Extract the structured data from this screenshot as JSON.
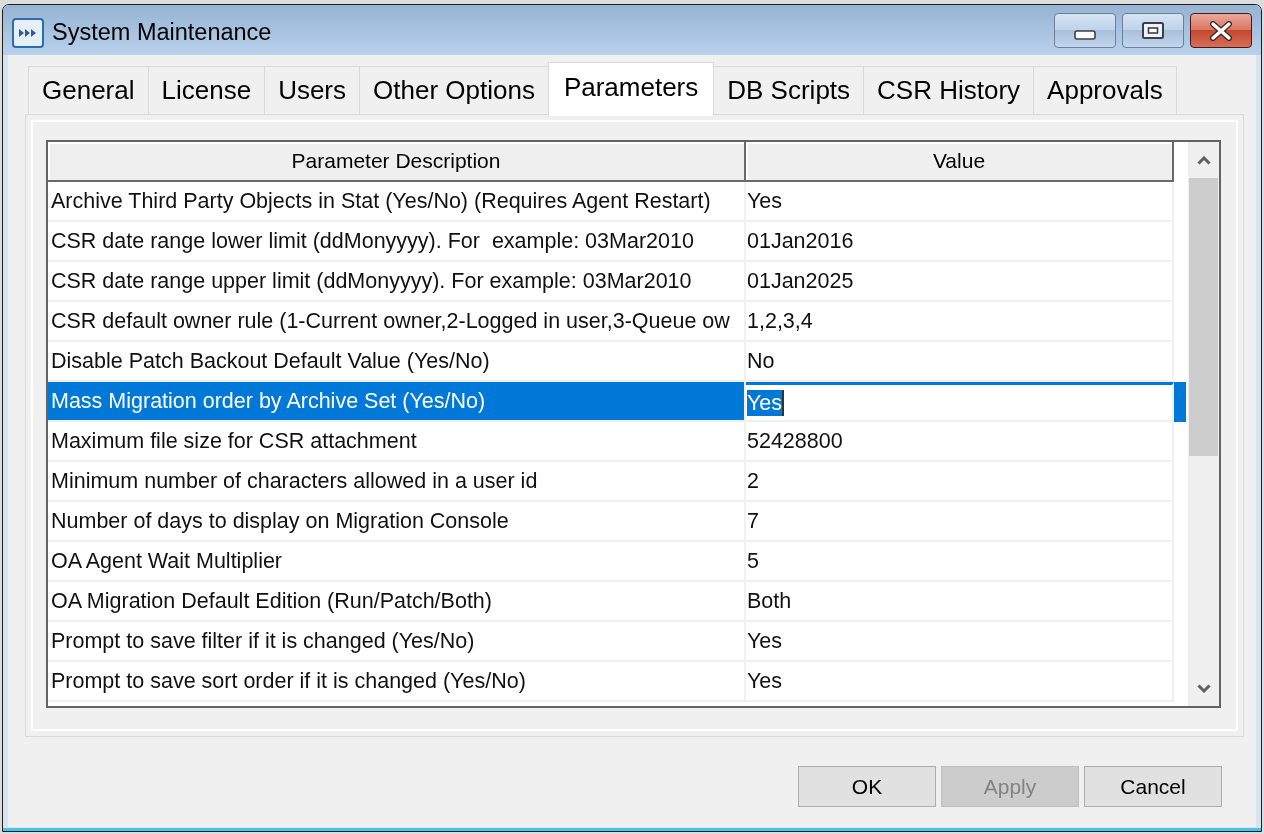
{
  "window": {
    "title": "System Maintenance"
  },
  "tabs": [
    {
      "label": "General",
      "selected": false
    },
    {
      "label": "License",
      "selected": false
    },
    {
      "label": "Users",
      "selected": false
    },
    {
      "label": "Other Options",
      "selected": false
    },
    {
      "label": "Parameters",
      "selected": true
    },
    {
      "label": "DB Scripts",
      "selected": false
    },
    {
      "label": "CSR History",
      "selected": false
    },
    {
      "label": "Approvals",
      "selected": false
    }
  ],
  "table": {
    "columns": [
      "Parameter Description",
      "Value"
    ],
    "rows": [
      {
        "description": "Archive Third Party Objects in Stat (Yes/No) (Requires Agent Restart)",
        "value": "Yes",
        "selected": false
      },
      {
        "description": "CSR date range lower limit (ddMonyyyy). For  example: 03Mar2010",
        "value": "01Jan2016",
        "selected": false
      },
      {
        "description": "CSR date range upper limit (ddMonyyyy). For example: 03Mar2010",
        "value": "01Jan2025",
        "selected": false
      },
      {
        "description": "CSR default owner rule (1-Current owner,2-Logged in user,3-Queue ow",
        "value": "1,2,3,4",
        "selected": false
      },
      {
        "description": "Disable Patch Backout Default Value (Yes/No)",
        "value": "No",
        "selected": false
      },
      {
        "description": "Mass Migration order by Archive Set (Yes/No)",
        "value": "Yes",
        "selected": true
      },
      {
        "description": "Maximum file size for CSR attachment",
        "value": "52428800",
        "selected": false
      },
      {
        "description": "Minimum number of characters allowed in a user id",
        "value": "2",
        "selected": false
      },
      {
        "description": "Number of days to display on Migration Console",
        "value": "7",
        "selected": false
      },
      {
        "description": "OA Agent Wait Multiplier",
        "value": "5",
        "selected": false
      },
      {
        "description": "OA Migration Default Edition (Run/Patch/Both)",
        "value": "Both",
        "selected": false
      },
      {
        "description": "Prompt to save filter if it is changed (Yes/No)",
        "value": "Yes",
        "selected": false
      },
      {
        "description": "Prompt to save sort order if it is changed (Yes/No)",
        "value": "Yes",
        "selected": false
      }
    ]
  },
  "buttons": [
    {
      "label": "OK",
      "disabled": false
    },
    {
      "label": "Apply",
      "disabled": true
    },
    {
      "label": "Cancel",
      "disabled": false
    }
  ]
}
